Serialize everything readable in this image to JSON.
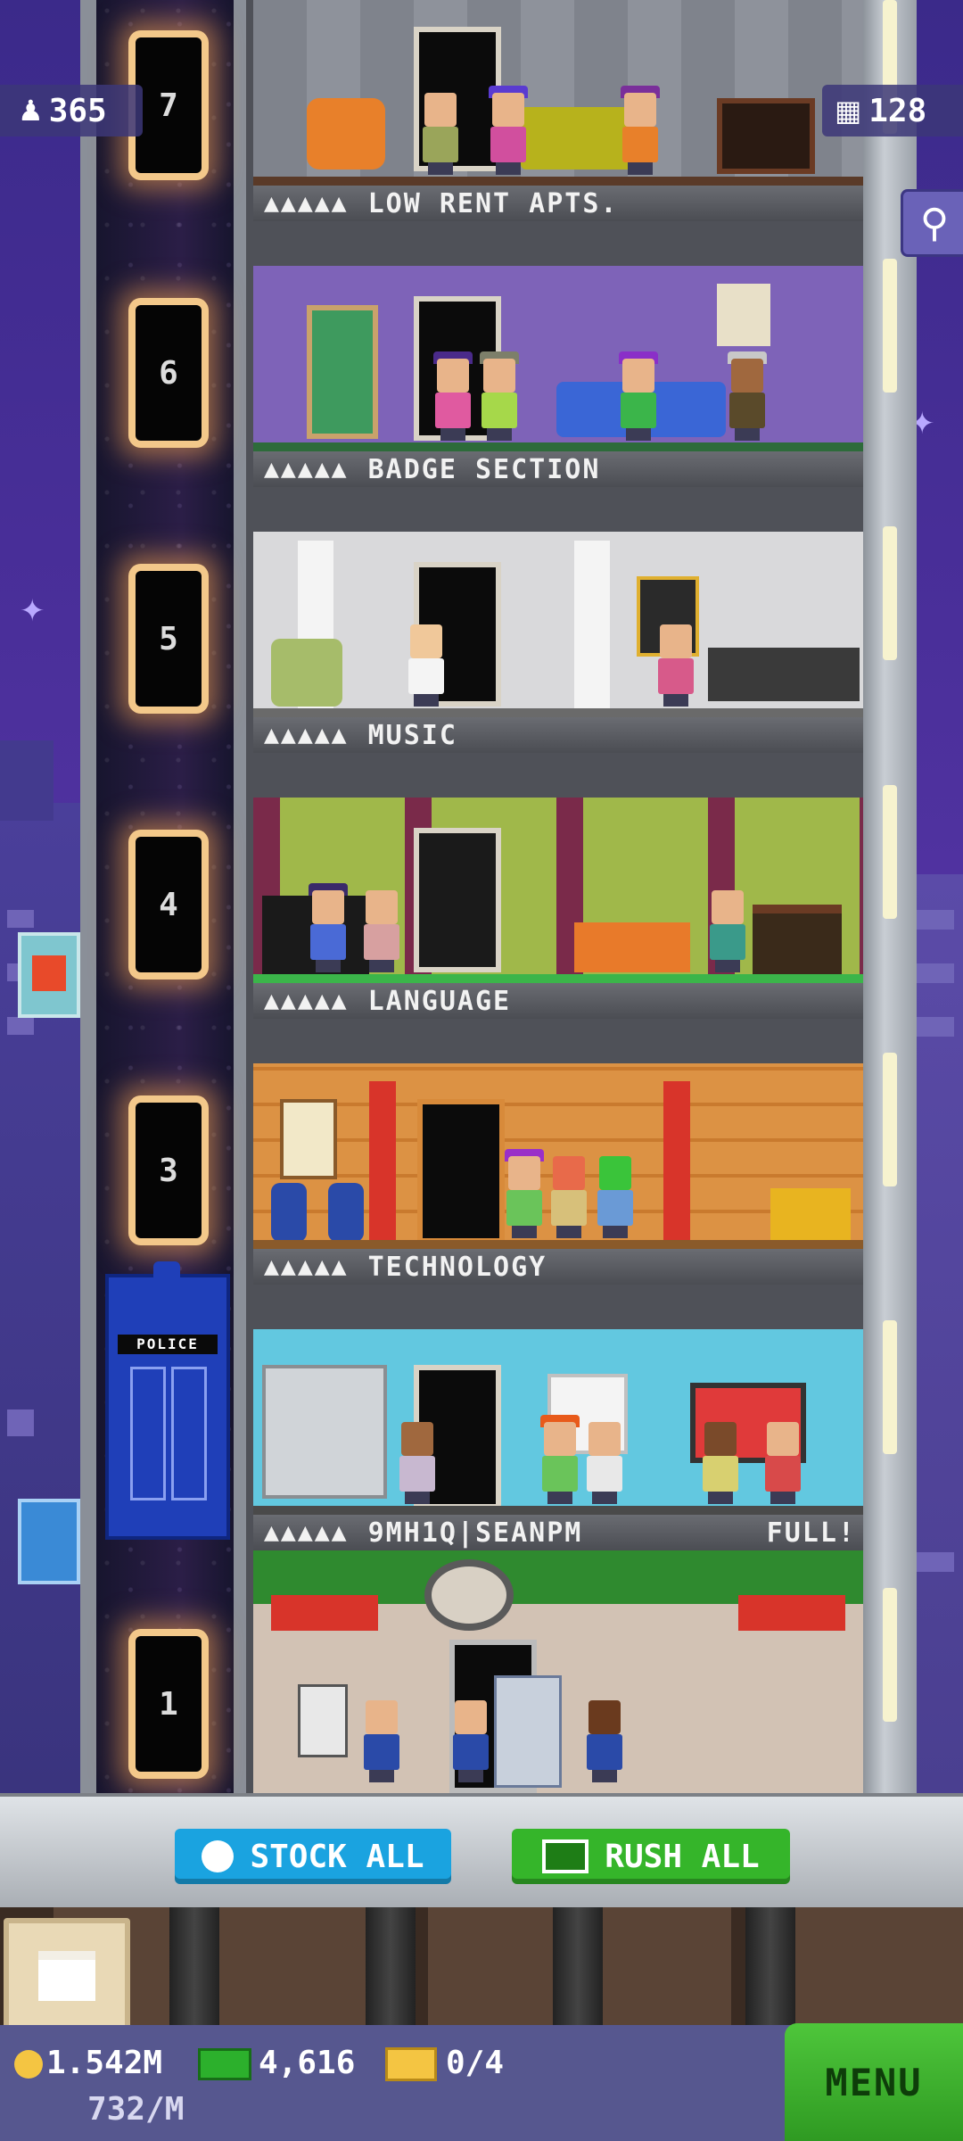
{
  "top_stats": {
    "population": "365",
    "floors": "128"
  },
  "shaft_floor_numbers": [
    "7",
    "6",
    "5",
    "4",
    "3",
    "1"
  ],
  "floors": [
    {
      "name": "LOW RENT APTS.",
      "stars": "▲▲▲▲▲",
      "status": ""
    },
    {
      "name": "BADGE SECTION",
      "stars": "▲▲▲▲▲",
      "status": ""
    },
    {
      "name": "MUSIC",
      "stars": "▲▲▲▲▲",
      "status": ""
    },
    {
      "name": "LANGUAGE",
      "stars": "▲▲▲▲▲",
      "status": ""
    },
    {
      "name": "TECHNOLOGY",
      "stars": "▲▲▲▲▲",
      "status": ""
    },
    {
      "name": "9MH1Q|SEANPM",
      "stars": "▲▲▲▲▲",
      "status": "FULL!"
    }
  ],
  "police_box_label": "POLICE",
  "buttons": {
    "stock_all": "STOCK ALL",
    "rush_all": "RUSH ALL",
    "menu": "MENU"
  },
  "currency": {
    "coins": "1.542M",
    "coins_rate": "732/M",
    "bux": "4,616",
    "tickets": "0/4"
  },
  "colors": {
    "stock_button": "#1aa3e0",
    "rush_button": "#35b52a",
    "menu_button": "#3fb830"
  },
  "icons": [
    "person-icon",
    "floors-icon",
    "search-icon",
    "clock-icon",
    "bux-icon",
    "coin-icon",
    "ticket-icon",
    "crate-icon"
  ]
}
